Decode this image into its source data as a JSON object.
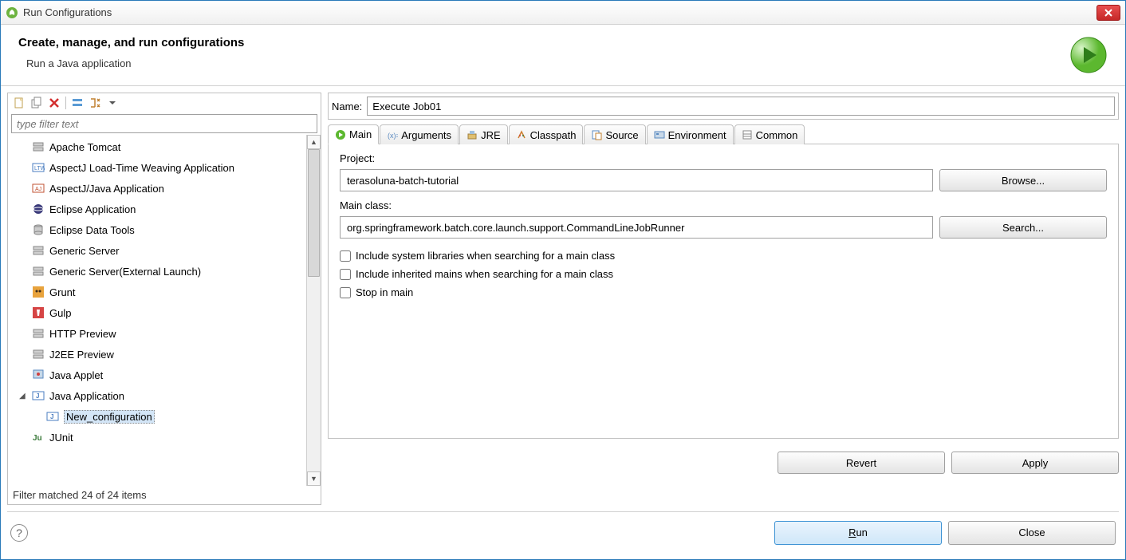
{
  "window": {
    "title": "Run Configurations"
  },
  "header": {
    "heading": "Create, manage, and run configurations",
    "subheading": "Run a Java application"
  },
  "filter": {
    "placeholder": "type filter text"
  },
  "tree": {
    "items": [
      {
        "label": "Apache Tomcat",
        "icon": "server"
      },
      {
        "label": "AspectJ Load-Time Weaving Application",
        "icon": "ltw"
      },
      {
        "label": "AspectJ/Java Application",
        "icon": "aj"
      },
      {
        "label": "Eclipse Application",
        "icon": "eclipse"
      },
      {
        "label": "Eclipse Data Tools",
        "icon": "db"
      },
      {
        "label": "Generic Server",
        "icon": "server"
      },
      {
        "label": "Generic Server(External Launch)",
        "icon": "server"
      },
      {
        "label": "Grunt",
        "icon": "grunt"
      },
      {
        "label": "Gulp",
        "icon": "gulp"
      },
      {
        "label": "HTTP Preview",
        "icon": "server"
      },
      {
        "label": "J2EE Preview",
        "icon": "server"
      },
      {
        "label": "Java Applet",
        "icon": "applet"
      },
      {
        "label": "Java Application",
        "icon": "java",
        "expanded": true,
        "children": [
          {
            "label": "New_configuration",
            "icon": "java",
            "selected": true
          }
        ]
      },
      {
        "label": "JUnit",
        "icon": "junit"
      }
    ]
  },
  "filter_status": "Filter matched 24 of 24 items",
  "name": {
    "label": "Name:",
    "value": "Execute Job01"
  },
  "tabs": [
    {
      "label": "Main",
      "active": true
    },
    {
      "label": "Arguments"
    },
    {
      "label": "JRE"
    },
    {
      "label": "Classpath"
    },
    {
      "label": "Source"
    },
    {
      "label": "Environment"
    },
    {
      "label": "Common"
    }
  ],
  "main_tab": {
    "project_label": "Project:",
    "project_value": "terasoluna-batch-tutorial",
    "browse_btn": "Browse...",
    "mainclass_label": "Main class:",
    "mainclass_value": "org.springframework.batch.core.launch.support.CommandLineJobRunner",
    "search_btn": "Search...",
    "check_syslib": "Include system libraries when searching for a main class",
    "check_inherited": "Include inherited mains when searching for a main class",
    "check_stop": "Stop in main"
  },
  "panel_buttons": {
    "revert": "Revert",
    "apply": "Apply"
  },
  "footer_buttons": {
    "run": "Run",
    "close": "Close"
  }
}
